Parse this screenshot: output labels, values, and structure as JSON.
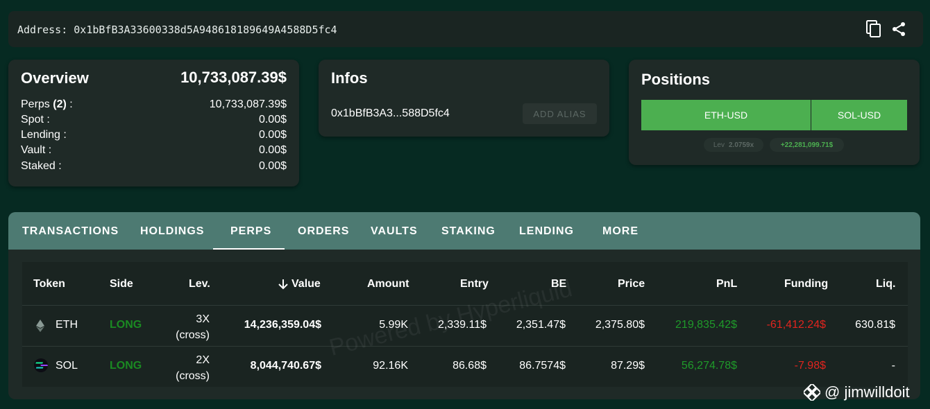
{
  "address_bar": {
    "text": "Address: 0x1bBfB3A33600338d5A948618189649A4588D5fc4"
  },
  "overview": {
    "title": "Overview",
    "total": "10,733,087.39$",
    "rows": [
      {
        "label_prefix": "Perps ",
        "label_bold": "(2)",
        "label_suffix": " :",
        "value": "10,733,087.39$"
      },
      {
        "label": "Spot :",
        "value": "0.00$"
      },
      {
        "label": "Lending :",
        "value": "0.00$"
      },
      {
        "label": "Vault :",
        "value": "0.00$"
      },
      {
        "label": "Staked :",
        "value": "0.00$"
      }
    ]
  },
  "infos": {
    "title": "Infos",
    "short_address": "0x1bBfB3A3...588D5fc4",
    "alias_button": "ADD ALIAS"
  },
  "positions": {
    "title": "Positions",
    "buttons": [
      "ETH-USD",
      "SOL-USD"
    ],
    "lev_label": "Lev",
    "lev_value": "2.0759x",
    "pnl": "+22,281,099.71$"
  },
  "tabs": [
    "TRANSACTIONS",
    "HOLDINGS",
    "PERPS",
    "ORDERS",
    "VAULTS",
    "STAKING",
    "LENDING",
    "MORE"
  ],
  "active_tab": "PERPS",
  "table": {
    "headers": {
      "token": "Token",
      "side": "Side",
      "lev": "Lev.",
      "value": "Value",
      "amount": "Amount",
      "entry": "Entry",
      "be": "BE",
      "price": "Price",
      "pnl": "PnL",
      "funding": "Funding",
      "liq": "Liq."
    },
    "rows": [
      {
        "token": "ETH",
        "side": "LONG",
        "lev": "3X",
        "lev_mode": "(cross)",
        "value": "14,236,359.04$",
        "amount": "5.99K",
        "entry": "2,339.11$",
        "be": "2,351.47$",
        "price": "2,375.80$",
        "pnl": "219,835.42$",
        "funding": "-61,412.24$",
        "liq": "630.81$"
      },
      {
        "token": "SOL",
        "side": "LONG",
        "lev": "2X",
        "lev_mode": "(cross)",
        "value": "8,044,740.67$",
        "amount": "92.16K",
        "entry": "86.68$",
        "be": "86.7574$",
        "price": "87.29$",
        "pnl": "56,274.78$",
        "funding": "-7.98$",
        "liq": "-"
      }
    ]
  },
  "watermark": "Powered by Hyperliquid",
  "attribution": "@ jimwilldoit",
  "colors": {
    "background": "#062a22",
    "accent_green": "#4caf50",
    "tab_bar": "#4d7a72",
    "pnl_positive": "#1f9a2a",
    "funding_negative": "#e0241e"
  }
}
